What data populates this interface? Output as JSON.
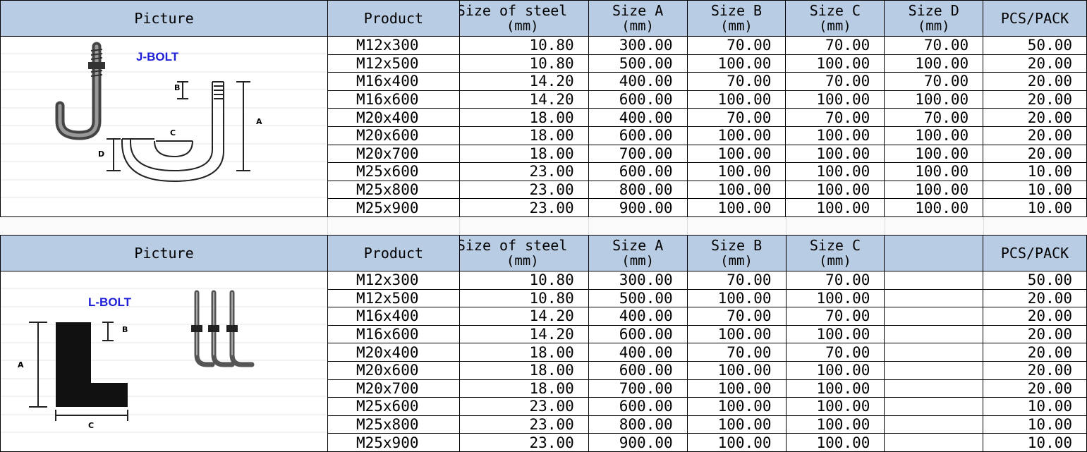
{
  "jbolt": {
    "headers": {
      "picture": "Picture",
      "product": "Product",
      "steel": "Size of steel",
      "size_a": "Size A",
      "size_b": "Size B",
      "size_c": "Size C",
      "size_d": "Size D",
      "unit": "(mm)",
      "pcs": "PCS/PACK"
    },
    "label": "J-BOLT",
    "diagram_labels": {
      "a": "A",
      "b": "B",
      "c": "C",
      "d": "D"
    },
    "rows": [
      {
        "product": "M12x300",
        "steel": "10.80",
        "a": "300.00",
        "b": "70.00",
        "c": "70.00",
        "d": "70.00",
        "pcs": "50.00"
      },
      {
        "product": "M12x500",
        "steel": "10.80",
        "a": "500.00",
        "b": "100.00",
        "c": "100.00",
        "d": "100.00",
        "pcs": "20.00"
      },
      {
        "product": "M16x400",
        "steel": "14.20",
        "a": "400.00",
        "b": "70.00",
        "c": "70.00",
        "d": "70.00",
        "pcs": "20.00"
      },
      {
        "product": "M16x600",
        "steel": "14.20",
        "a": "600.00",
        "b": "100.00",
        "c": "100.00",
        "d": "100.00",
        "pcs": "20.00"
      },
      {
        "product": "M20x400",
        "steel": "18.00",
        "a": "400.00",
        "b": "70.00",
        "c": "70.00",
        "d": "70.00",
        "pcs": "20.00"
      },
      {
        "product": "M20x600",
        "steel": "18.00",
        "a": "600.00",
        "b": "100.00",
        "c": "100.00",
        "d": "100.00",
        "pcs": "20.00"
      },
      {
        "product": "M20x700",
        "steel": "18.00",
        "a": "700.00",
        "b": "100.00",
        "c": "100.00",
        "d": "100.00",
        "pcs": "20.00"
      },
      {
        "product": "M25x600",
        "steel": "23.00",
        "a": "600.00",
        "b": "100.00",
        "c": "100.00",
        "d": "100.00",
        "pcs": "10.00"
      },
      {
        "product": "M25x800",
        "steel": "23.00",
        "a": "800.00",
        "b": "100.00",
        "c": "100.00",
        "d": "100.00",
        "pcs": "10.00"
      },
      {
        "product": "M25x900",
        "steel": "23.00",
        "a": "900.00",
        "b": "100.00",
        "c": "100.00",
        "d": "100.00",
        "pcs": "10.00"
      }
    ]
  },
  "lbolt": {
    "headers": {
      "picture": "Picture",
      "product": "Product",
      "steel": "Size of steel",
      "size_a": "Size A",
      "size_b": "Size B",
      "size_c": "Size C",
      "unit": "(mm)",
      "pcs": "PCS/PACK"
    },
    "label": "L-BOLT",
    "diagram_labels": {
      "a": "A",
      "b": "B",
      "c": "C"
    },
    "rows": [
      {
        "product": "M12x300",
        "steel": "10.80",
        "a": "300.00",
        "b": "70.00",
        "c": "70.00",
        "pcs": "50.00"
      },
      {
        "product": "M12x500",
        "steel": "10.80",
        "a": "500.00",
        "b": "100.00",
        "c": "100.00",
        "pcs": "20.00"
      },
      {
        "product": "M16x400",
        "steel": "14.20",
        "a": "400.00",
        "b": "70.00",
        "c": "70.00",
        "pcs": "20.00"
      },
      {
        "product": "M16x600",
        "steel": "14.20",
        "a": "600.00",
        "b": "100.00",
        "c": "100.00",
        "pcs": "20.00"
      },
      {
        "product": "M20x400",
        "steel": "18.00",
        "a": "400.00",
        "b": "70.00",
        "c": "70.00",
        "pcs": "20.00"
      },
      {
        "product": "M20x600",
        "steel": "18.00",
        "a": "600.00",
        "b": "100.00",
        "c": "100.00",
        "pcs": "20.00"
      },
      {
        "product": "M20x700",
        "steel": "18.00",
        "a": "700.00",
        "b": "100.00",
        "c": "100.00",
        "pcs": "20.00"
      },
      {
        "product": "M25x600",
        "steel": "23.00",
        "a": "600.00",
        "b": "100.00",
        "c": "100.00",
        "pcs": "10.00"
      },
      {
        "product": "M25x800",
        "steel": "23.00",
        "a": "800.00",
        "b": "100.00",
        "c": "100.00",
        "pcs": "10.00"
      },
      {
        "product": "M25x900",
        "steel": "23.00",
        "a": "900.00",
        "b": "100.00",
        "c": "100.00",
        "pcs": "10.00"
      }
    ]
  },
  "colors": {
    "header_bg": "#b8cce4",
    "bolt_label": "#1f1fd8"
  },
  "icons": {
    "jbolt_picture": "j-bolt-diagram-icon",
    "lbolt_picture": "l-bolt-diagram-icon"
  }
}
